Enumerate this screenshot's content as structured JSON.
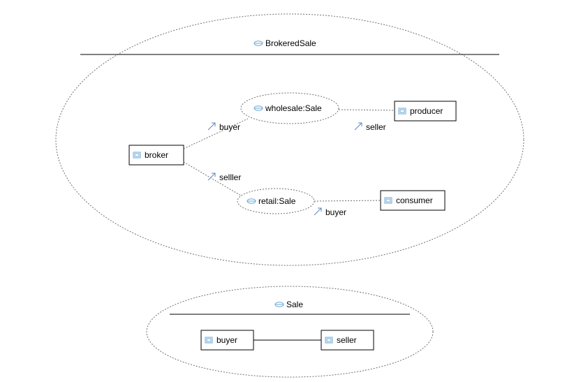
{
  "diagram": {
    "top": {
      "title": "BrokeredSale",
      "nodes": {
        "broker": "broker",
        "wholesale": "wholesale:Sale",
        "retail": "retail:Sale",
        "producer": "producer",
        "consumer": "consumer"
      },
      "roles": {
        "buyer_top": "buyer",
        "seller_top": "seller",
        "seller_mid": "selller",
        "buyer_bottom": "buyer"
      }
    },
    "bottom": {
      "title": "Sale",
      "nodes": {
        "buyer": "buyer",
        "seller": "seller"
      }
    }
  }
}
